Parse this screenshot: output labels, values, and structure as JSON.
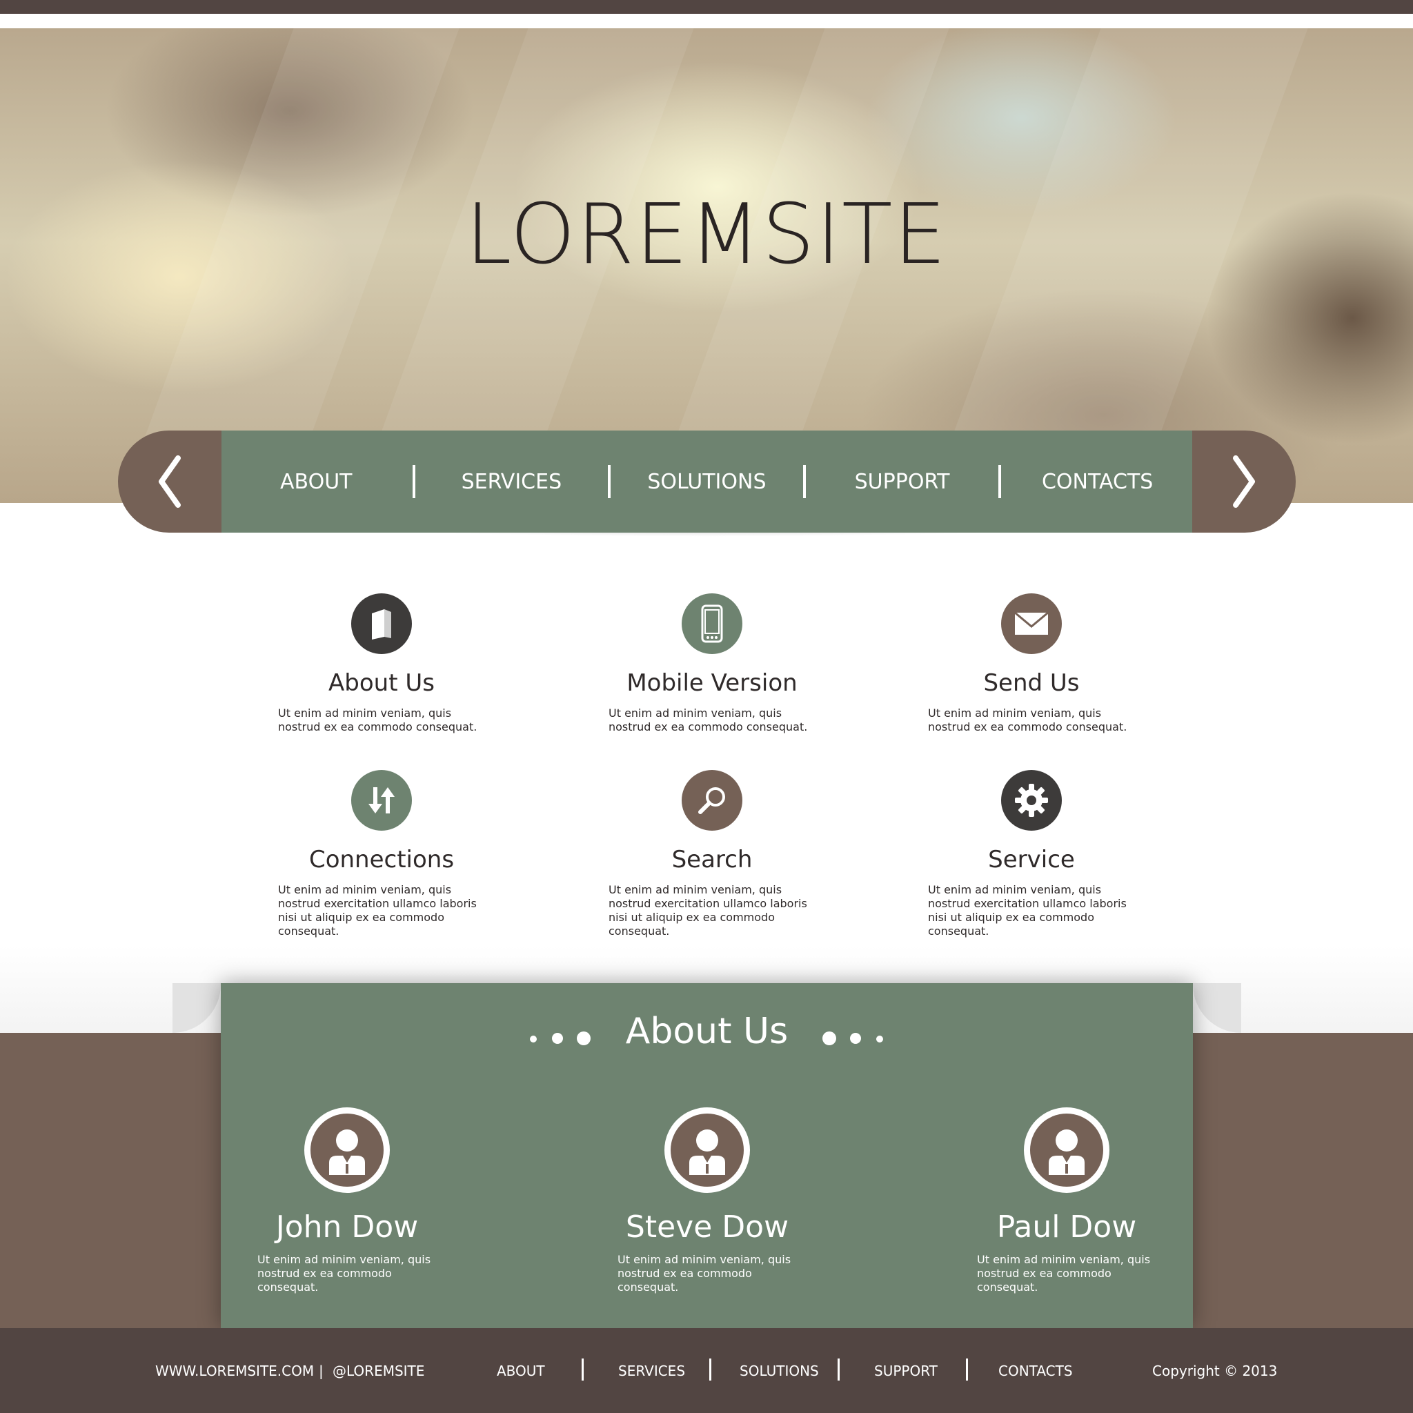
{
  "site": {
    "title": "LOREMSITE"
  },
  "nav": {
    "items": [
      "ABOUT",
      "SERVICES",
      "SOLUTIONS",
      "SUPPORT",
      "CONTACTS"
    ],
    "prev_icon": "chevron-left-icon",
    "next_icon": "chevron-right-icon"
  },
  "features": [
    {
      "title": "About Us",
      "text": "Ut enim ad minim veniam, quis nostrud ex ea commodo consequat.",
      "icon": "book-icon",
      "color": "#3d3b3a"
    },
    {
      "title": "Mobile Version",
      "text": "Ut enim ad minim veniam, quis nostrud ex ea commodo consequat.",
      "icon": "mobile-phone-icon",
      "color": "#6e8370"
    },
    {
      "title": "Send Us",
      "text": "Ut enim ad minim veniam, quis nostrud ex ea commodo consequat.",
      "icon": "envelope-icon",
      "color": "#756156"
    },
    {
      "title": "Connections",
      "text": "Ut enim ad minim veniam, quis nostrud exercitation ullamco laboris nisi ut aliquip ex ea commodo consequat.",
      "icon": "arrows-exchange-icon",
      "color": "#6e8370"
    },
    {
      "title": "Search",
      "text": "Ut enim ad minim veniam, quis nostrud exercitation ullamco laboris nisi ut aliquip ex ea commodo consequat.",
      "icon": "magnifier-icon",
      "color": "#756156"
    },
    {
      "title": "Service",
      "text": "Ut enim ad minim veniam, quis nostrud exercitation ullamco laboris nisi ut aliquip ex ea commodo consequat.",
      "icon": "gear-icon",
      "color": "#3d3b3a"
    }
  ],
  "about": {
    "heading": "About Us",
    "members": [
      {
        "name": "John Dow",
        "text": "Ut enim ad minim veniam, quis nostrud ex ea commodo consequat."
      },
      {
        "name": "Steve Dow",
        "text": "Ut enim ad minim veniam, quis nostrud ex ea commodo consequat."
      },
      {
        "name": "Paul Dow",
        "text": "Ut enim ad minim veniam, quis nostrud ex ea commodo consequat."
      }
    ]
  },
  "footer": {
    "website": "WWW.LOREMSITE.COM",
    "divider": "|",
    "handle": "@LOREMSITE",
    "nav": [
      "ABOUT",
      "SERVICES",
      "SOLUTIONS",
      "SUPPORT",
      "CONTACTS"
    ],
    "copyright": "Copyright © 2013"
  },
  "colors": {
    "dark_brown": "#524542",
    "brown": "#756156",
    "green": "#6e8370",
    "charcoal": "#3d3b3a"
  }
}
